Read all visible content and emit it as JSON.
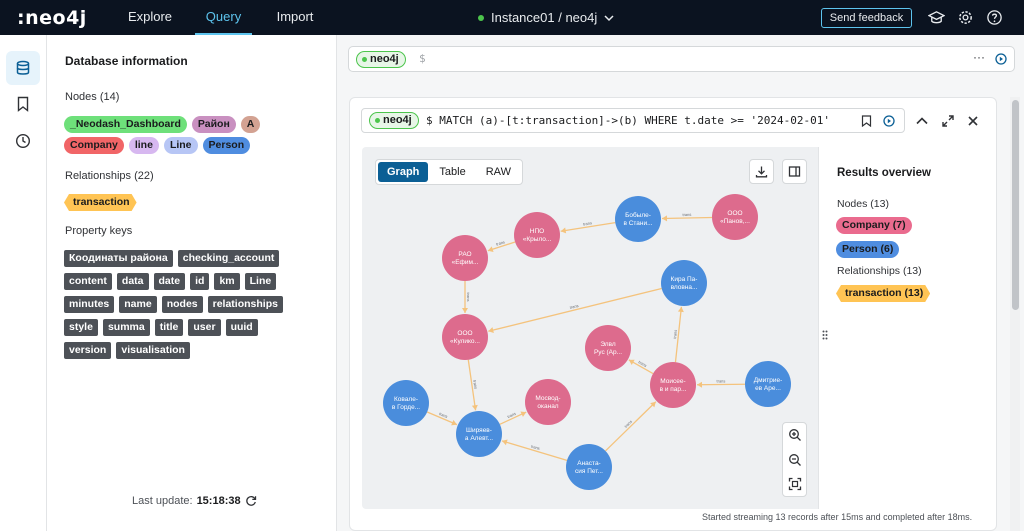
{
  "topbar": {
    "logo": ":neo4j",
    "tabs": [
      "Explore",
      "Query",
      "Import"
    ],
    "active_tab": "Query",
    "instance": "Instance01 / neo4j",
    "feedback_label": "Send feedback"
  },
  "db_info": {
    "title": "Database information",
    "nodes_label": "Nodes (14)",
    "node_labels": [
      {
        "name": "_Neodash_Dashboard",
        "color": "#6ee07a"
      },
      {
        "name": "Район",
        "color": "#c990c0"
      },
      {
        "name": "A",
        "color": "#d3a292"
      },
      {
        "name": "Company",
        "color": "#f16567"
      },
      {
        "name": "line",
        "color": "#d7b8f0"
      },
      {
        "name": "Line",
        "color": "#b7c6f5"
      },
      {
        "name": "Person",
        "color": "#4f8de0"
      }
    ],
    "relationships_label": "Relationships (22)",
    "relationship_types": [
      "transaction"
    ],
    "property_keys_label": "Property keys",
    "property_keys": [
      "Коодинаты района",
      "checking_account",
      "content",
      "data",
      "date",
      "id",
      "km",
      "Line",
      "minutes",
      "name",
      "nodes",
      "relationships",
      "style",
      "summa",
      "title",
      "user",
      "uuid",
      "version",
      "visualisation"
    ],
    "last_update_label": "Last update:",
    "last_update_time": "15:18:38"
  },
  "editor": {
    "db_pill": "neo4j",
    "prompt": "$",
    "more": "···"
  },
  "result": {
    "db_pill": "neo4j",
    "query": "$ MATCH (a)-[t:transaction]->(b) WHERE t.date >= '2024-02-01'",
    "view_tabs": [
      "Graph",
      "Table",
      "RAW"
    ],
    "active_view": "Graph",
    "overview": {
      "title": "Results overview",
      "nodes_label": "Nodes (13)",
      "node_chips": [
        {
          "name": "Company (7)",
          "color": "#ea6b8e"
        },
        {
          "name": "Person (6)",
          "color": "#4f8de0"
        }
      ],
      "relationships_label": "Relationships (13)",
      "rel_chips": [
        "transaction (13)"
      ]
    },
    "status": "Started streaming 13 records after 15ms and completed after 18ms."
  },
  "graph": {
    "company_color": "#dd6b8d",
    "person_color": "#4a8ddc",
    "edge_color": "#f4c37d",
    "nodes": [
      {
        "id": "n1",
        "label": [
          "РАО",
          "«Ефим..."
        ],
        "type": "company"
      },
      {
        "id": "n2",
        "label": [
          "НПО",
          "«Крыло..."
        ],
        "type": "company"
      },
      {
        "id": "n3",
        "label": [
          "Бобыле-",
          "в Стани..."
        ],
        "type": "person"
      },
      {
        "id": "n4",
        "label": [
          "ООО",
          "«Панов,..."
        ],
        "type": "company"
      },
      {
        "id": "n5",
        "label": [
          "Кира Па-",
          "вловна..."
        ],
        "type": "person"
      },
      {
        "id": "n6",
        "label": [
          "ООО",
          "«Кулико..."
        ],
        "type": "company"
      },
      {
        "id": "n7",
        "label": [
          "Элвл",
          "Рус (Ар..."
        ],
        "type": "company"
      },
      {
        "id": "n8",
        "label": [
          "Моисее-",
          "в и пар..."
        ],
        "type": "company"
      },
      {
        "id": "n9",
        "label": [
          "Дмитрие-",
          "ев Аре..."
        ],
        "type": "person"
      },
      {
        "id": "n10",
        "label": [
          "Ковале-",
          "в Горде..."
        ],
        "type": "person"
      },
      {
        "id": "n11",
        "label": [
          "Мосвод-",
          "оканал"
        ],
        "type": "company"
      },
      {
        "id": "n12",
        "label": [
          "Ширяев-",
          "а Алевт..."
        ],
        "type": "person"
      },
      {
        "id": "n13",
        "label": [
          "Анаста-",
          "сия Пет..."
        ],
        "type": "person"
      }
    ],
    "edges": [
      {
        "from": "n4",
        "to": "n3",
        "label": "trans"
      },
      {
        "from": "n3",
        "to": "n2",
        "label": "trans"
      },
      {
        "from": "n2",
        "to": "n1",
        "label": "trans"
      },
      {
        "from": "n1",
        "to": "n6",
        "label": "trans"
      },
      {
        "from": "n5",
        "to": "n6",
        "label": "trans"
      },
      {
        "from": "n8",
        "to": "n5",
        "label": "trans"
      },
      {
        "from": "n9",
        "to": "n8",
        "label": "trans"
      },
      {
        "from": "n8",
        "to": "n7",
        "label": "trans"
      },
      {
        "from": "n13",
        "to": "n8",
        "label": "trans"
      },
      {
        "from": "n13",
        "to": "n12",
        "label": "trans"
      },
      {
        "from": "n10",
        "to": "n12",
        "label": "trans"
      },
      {
        "from": "n12",
        "to": "n11",
        "label": "trans"
      },
      {
        "from": "n6",
        "to": "n12",
        "label": "trans"
      }
    ]
  }
}
